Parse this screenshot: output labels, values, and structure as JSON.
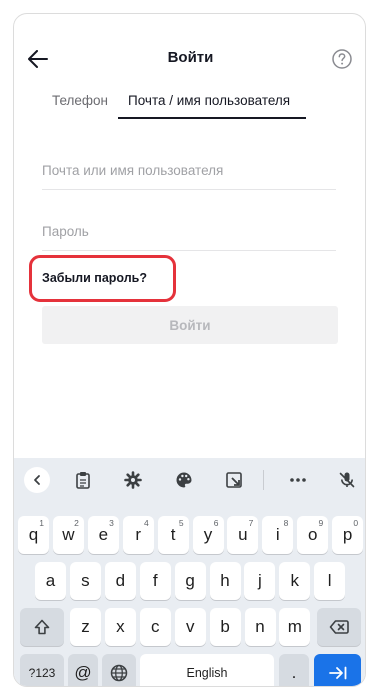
{
  "header": {
    "title": "Войти"
  },
  "tabs": [
    {
      "label": "Телефон"
    },
    {
      "label": "Почта / имя пользователя"
    }
  ],
  "form": {
    "email_placeholder": "Почта или имя пользователя",
    "password_placeholder": "Пароль",
    "forgot_label": "Забыли пароль?",
    "login_label": "Войти"
  },
  "colors": {
    "highlight": "#e5323b",
    "enter_key": "#1a73e8",
    "disabled_button_bg": "#f1f1f2"
  },
  "keyboard": {
    "toolbar_icons": [
      "chevron-left-icon",
      "clipboard-icon",
      "gear-icon",
      "palette-icon",
      "resize-icon",
      "more-icon",
      "mic-off-icon"
    ],
    "row1": [
      {
        "k": "q",
        "h": "1"
      },
      {
        "k": "w",
        "h": "2"
      },
      {
        "k": "e",
        "h": "3"
      },
      {
        "k": "r",
        "h": "4"
      },
      {
        "k": "t",
        "h": "5"
      },
      {
        "k": "y",
        "h": "6"
      },
      {
        "k": "u",
        "h": "7"
      },
      {
        "k": "i",
        "h": "8"
      },
      {
        "k": "o",
        "h": "9"
      },
      {
        "k": "p",
        "h": "0"
      }
    ],
    "row2": [
      "a",
      "s",
      "d",
      "f",
      "g",
      "h",
      "j",
      "k",
      "l"
    ],
    "row3": [
      "z",
      "x",
      "c",
      "v",
      "b",
      "n",
      "m"
    ],
    "symbols_label": "?123",
    "at_label": "@",
    "space_label": "English",
    "period_label": "."
  }
}
